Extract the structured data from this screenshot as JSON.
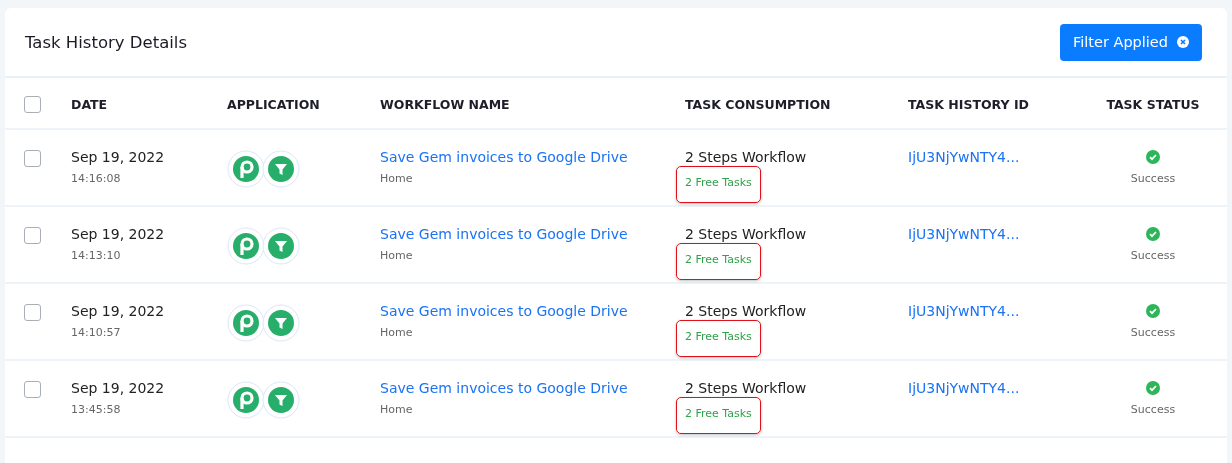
{
  "card": {
    "title": "Task History Details",
    "filter_button": "Filter Applied"
  },
  "table": {
    "columns": [
      "DATE",
      "APPLICATION",
      "WORKFLOW NAME",
      "TASK CONSUMPTION",
      "TASK HISTORY ID",
      "TASK STATUS"
    ],
    "select_all": {
      "checked": false
    },
    "rows": [
      {
        "checked": false,
        "date": "Sep 19, 2022",
        "time": "14:16:08",
        "workflow": "Save Gem invoices to Google Drive",
        "folder": "Home",
        "consumption": "2 Steps Workflow",
        "free_tasks": "2 Free Tasks",
        "highlighted": true,
        "history_id": "IjU3NjYwNTY4...",
        "status": "Success"
      },
      {
        "checked": false,
        "date": "Sep 19, 2022",
        "time": "14:13:10",
        "workflow": "Save Gem invoices to Google Drive",
        "folder": "Home",
        "consumption": "2 Steps Workflow",
        "free_tasks": "2 Free Tasks",
        "highlighted": true,
        "history_id": "IjU3NjYwNTY4...",
        "status": "Success"
      },
      {
        "checked": false,
        "date": "Sep 19, 2022",
        "time": "14:10:57",
        "workflow": "Save Gem invoices to Google Drive",
        "folder": "Home",
        "consumption": "2 Steps Workflow",
        "free_tasks": "2 Free Tasks",
        "highlighted": true,
        "history_id": "IjU3NjYwNTY4...",
        "status": "Success"
      },
      {
        "checked": false,
        "date": "Sep 19, 2022",
        "time": "13:45:58",
        "workflow": "Save Gem invoices to Google Drive",
        "folder": "Home",
        "consumption": "2 Steps Workflow",
        "free_tasks": "2 Free Tasks",
        "highlighted": true,
        "history_id": "IjU3NjYwNTY4...",
        "status": "Success"
      }
    ]
  }
}
